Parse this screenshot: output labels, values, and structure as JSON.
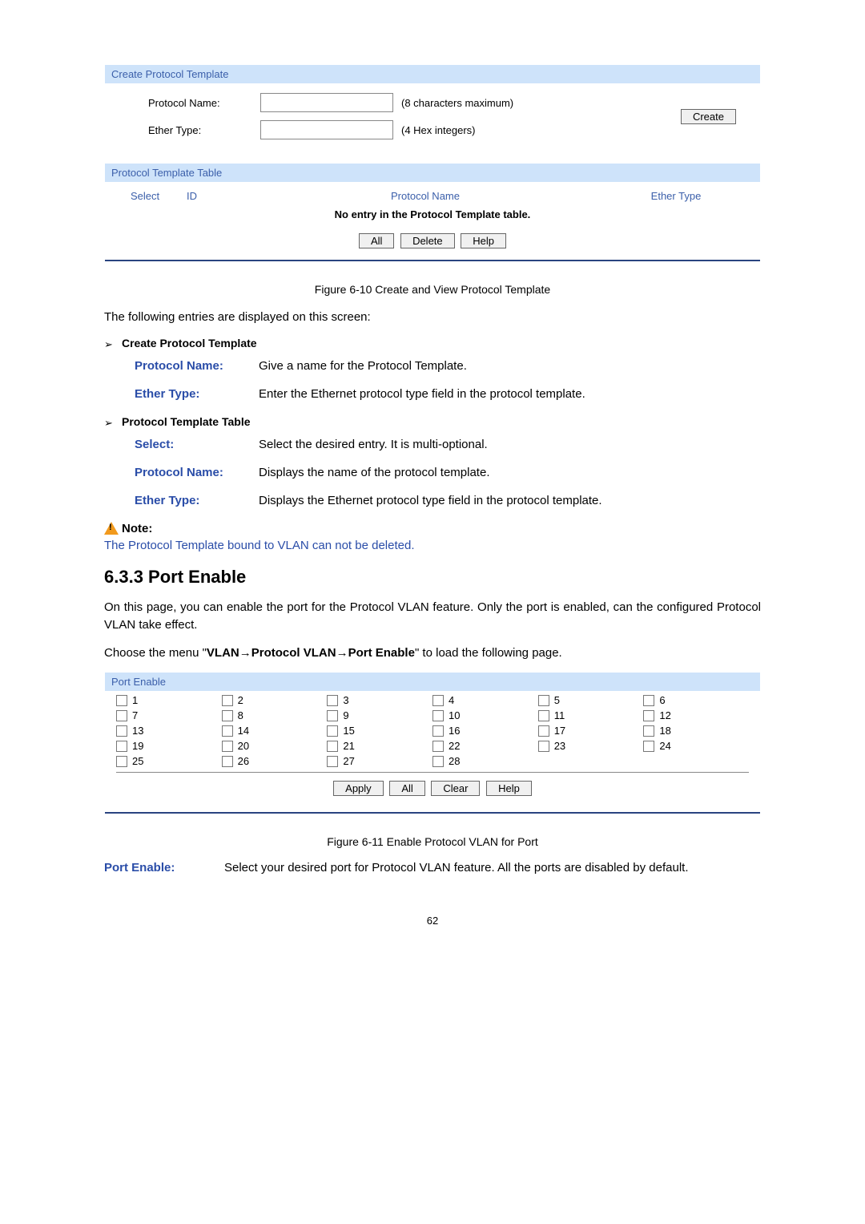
{
  "panel1": {
    "title": "Create Protocol Template",
    "protocol_name_label": "Protocol Name:",
    "protocol_name_hint": "(8 characters maximum)",
    "ether_type_label": "Ether Type:",
    "ether_type_hint": "(4 Hex integers)",
    "create_btn": "Create"
  },
  "panel2": {
    "title": "Protocol Template Table",
    "th_select": "Select",
    "th_id": "ID",
    "th_pn": "Protocol Name",
    "th_et": "Ether Type",
    "no_entry": "No entry in the Protocol Template table."
  },
  "buttons": {
    "all": "All",
    "delete": "Delete",
    "help": "Help",
    "apply": "Apply",
    "clear": "Clear"
  },
  "fig1": "Figure 6-10 Create and View Protocol Template",
  "intro": "The following entries are displayed on this screen:",
  "sec1_title": "Create Protocol Template",
  "sec1": {
    "pn_label": "Protocol Name:",
    "pn_desc": "Give a name for the Protocol Template.",
    "et_label": "Ether Type:",
    "et_desc": "Enter the Ethernet protocol type field in the protocol template."
  },
  "sec2_title": "Protocol Template Table",
  "sec2": {
    "sel_label": "Select:",
    "sel_desc": "Select the desired entry. It is multi-optional.",
    "pn_label": "Protocol Name:",
    "pn_desc": "Displays the name of the protocol template.",
    "et_label": "Ether Type:",
    "et_desc": "Displays the Ethernet protocol type field in the protocol template."
  },
  "note_label": "Note:",
  "note_body": "The Protocol Template bound to VLAN can not be deleted.",
  "h2": "6.3.3 Port Enable",
  "p1": "On this page, you can enable the port for the Protocol VLAN feature. Only the port is enabled, can the configured Protocol VLAN take effect.",
  "p2a": "Choose the menu \"",
  "p2b": "VLAN→Protocol VLAN→Port Enable",
  "p2c": "\" to load the following page.",
  "panel3": {
    "title": "Port Enable"
  },
  "ports": [
    "1",
    "2",
    "3",
    "4",
    "5",
    "6",
    "7",
    "8",
    "9",
    "10",
    "11",
    "12",
    "13",
    "14",
    "15",
    "16",
    "17",
    "18",
    "19",
    "20",
    "21",
    "22",
    "23",
    "24",
    "25",
    "26",
    "27",
    "28"
  ],
  "fig2": "Figure 6-11 Enable Protocol VLAN for Port",
  "pe_label": "Port Enable:",
  "pe_desc": "Select your desired port for Protocol VLAN feature. All the ports are disabled by default.",
  "page_number": "62"
}
